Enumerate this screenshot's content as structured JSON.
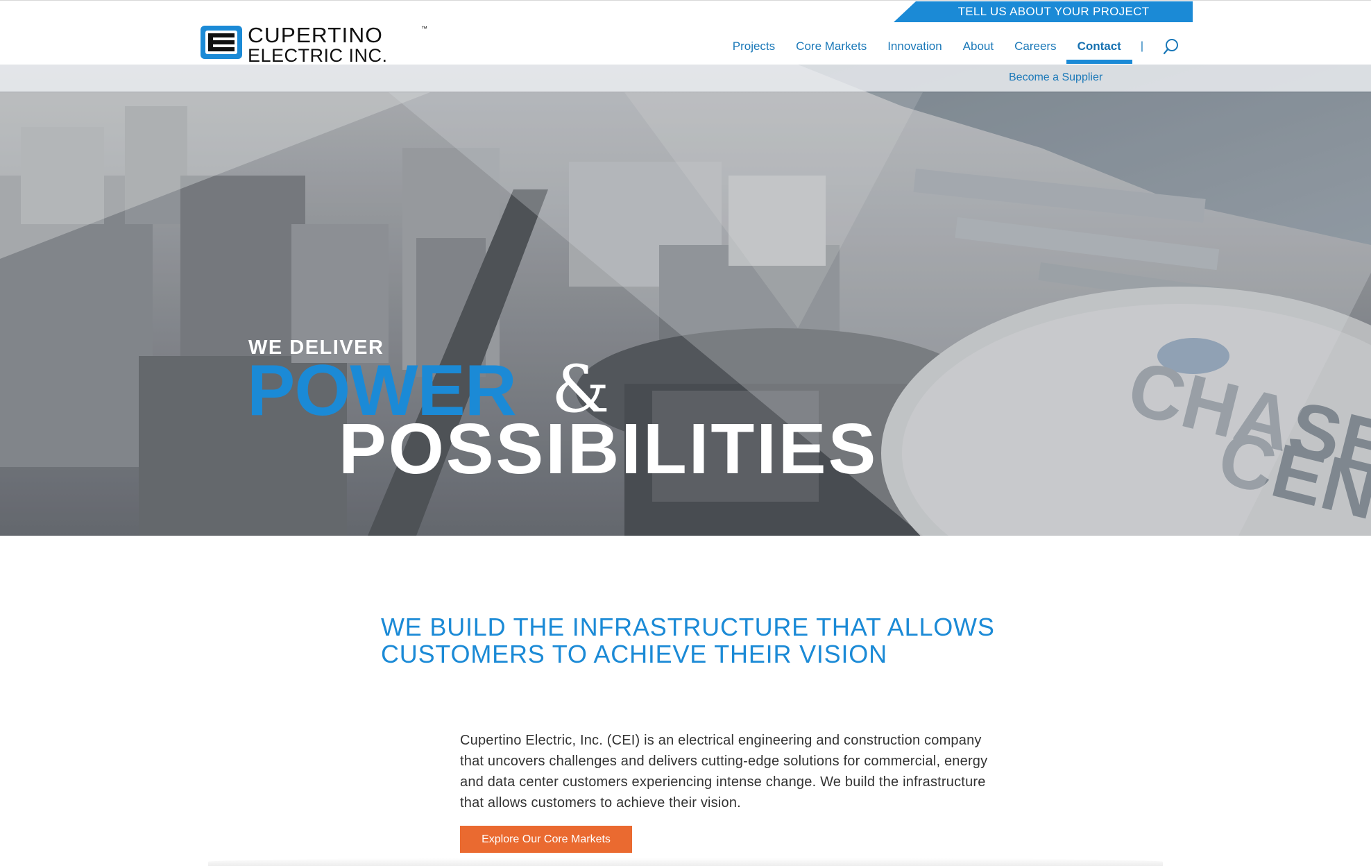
{
  "header": {
    "cta_label": "TELL US ABOUT YOUR PROJECT",
    "logo": {
      "line1": "CUPERTINO",
      "line2": "ELECTRIC INC.",
      "tm": "™"
    },
    "nav": [
      {
        "label": "Projects",
        "active": false
      },
      {
        "label": "Core Markets",
        "active": false
      },
      {
        "label": "Innovation",
        "active": false
      },
      {
        "label": "About",
        "active": false
      },
      {
        "label": "Careers",
        "active": false
      },
      {
        "label": "Contact",
        "active": true
      }
    ],
    "separator": "|",
    "search_icon": "search-icon"
  },
  "subnav": {
    "link": "Become a Supplier"
  },
  "hero": {
    "kicker": "WE DELIVER",
    "word1": "POWER",
    "amp": "&",
    "word2": "POSSIBILITIES"
  },
  "main": {
    "headline": "WE BUILD THE INFRASTRUCTURE THAT ALLOWS CUSTOMERS TO ACHIEVE THEIR VISION",
    "description": "Cupertino Electric, Inc. (CEI) is an electrical engineering and construction company that uncovers challenges and delivers cutting-edge solutions for commercial, energy and data center customers experiencing intense change. We build the infrastructure that allows customers to achieve their vision.",
    "button_label": "Explore Our Core Markets"
  },
  "colors": {
    "brand_blue": "#1b8ad6",
    "cta_orange": "#ea6a30",
    "text_dark": "#333333"
  }
}
